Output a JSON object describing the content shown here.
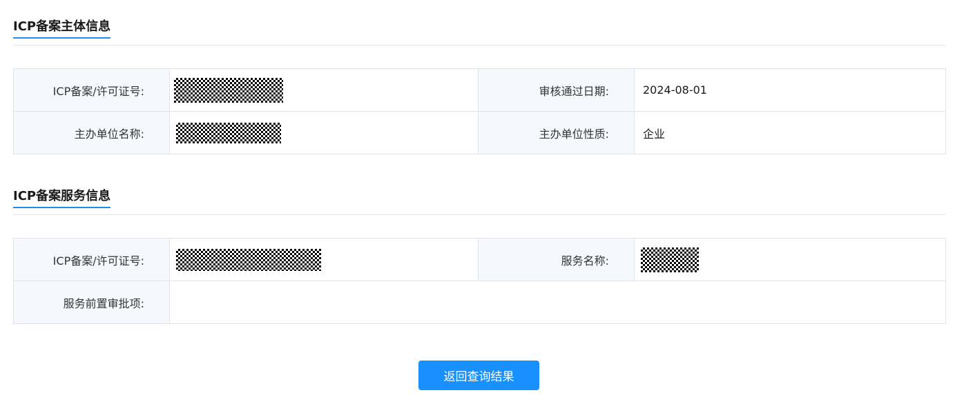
{
  "subject_section": {
    "title": "ICP备案主体信息",
    "rows": [
      {
        "label1": "ICP备案/许可证号:",
        "label2": "审核通过日期:",
        "value2": "2024-08-01"
      },
      {
        "label1": "主办单位名称:",
        "label2": "主办单位性质:",
        "value2": "企业"
      }
    ]
  },
  "service_section": {
    "title": "ICP备案服务信息",
    "rows": [
      {
        "label1": "ICP备案/许可证号:",
        "label2": "服务名称:"
      },
      {
        "label1": "服务前置审批项:",
        "value1": ""
      }
    ]
  },
  "actions": {
    "return_label": "返回查询结果",
    "accent_color": "#1890ff"
  }
}
